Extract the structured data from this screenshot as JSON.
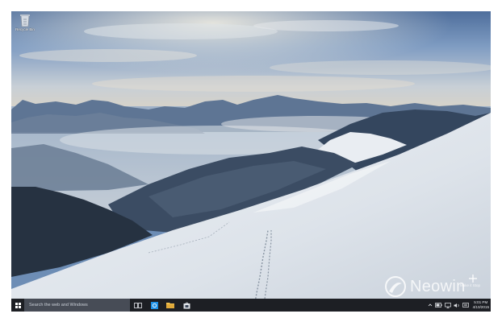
{
  "desktop": {
    "icons": [
      {
        "label": "Recycle Bin",
        "icon": "recycle-bin-icon"
      }
    ],
    "watermark": {
      "logo": "neowin-logo",
      "text": "Neowin"
    },
    "corner_hint": {
      "icon": "plus-icon",
      "caption": "Make it Stop"
    }
  },
  "taskbar": {
    "start_icon": "windows-logo-icon",
    "search_placeholder": "Search the web and Windows",
    "buttons": [
      {
        "name": "task-view",
        "icon": "task-view-icon"
      },
      {
        "name": "edge",
        "icon": "browser-icon"
      },
      {
        "name": "file-explorer",
        "icon": "folder-icon"
      },
      {
        "name": "store",
        "icon": "store-icon"
      }
    ],
    "tray": {
      "icons": [
        "chevron-up-icon",
        "battery-icon",
        "network-icon",
        "volume-icon",
        "notifications-icon"
      ],
      "time": "5:01 PM",
      "date": "4/10/2015"
    }
  },
  "colors": {
    "taskbar_bg": "#1d1f24",
    "search_bg": "#474c56",
    "accent_edge": "#1e90e6",
    "accent_folder": "#f2c14e"
  }
}
